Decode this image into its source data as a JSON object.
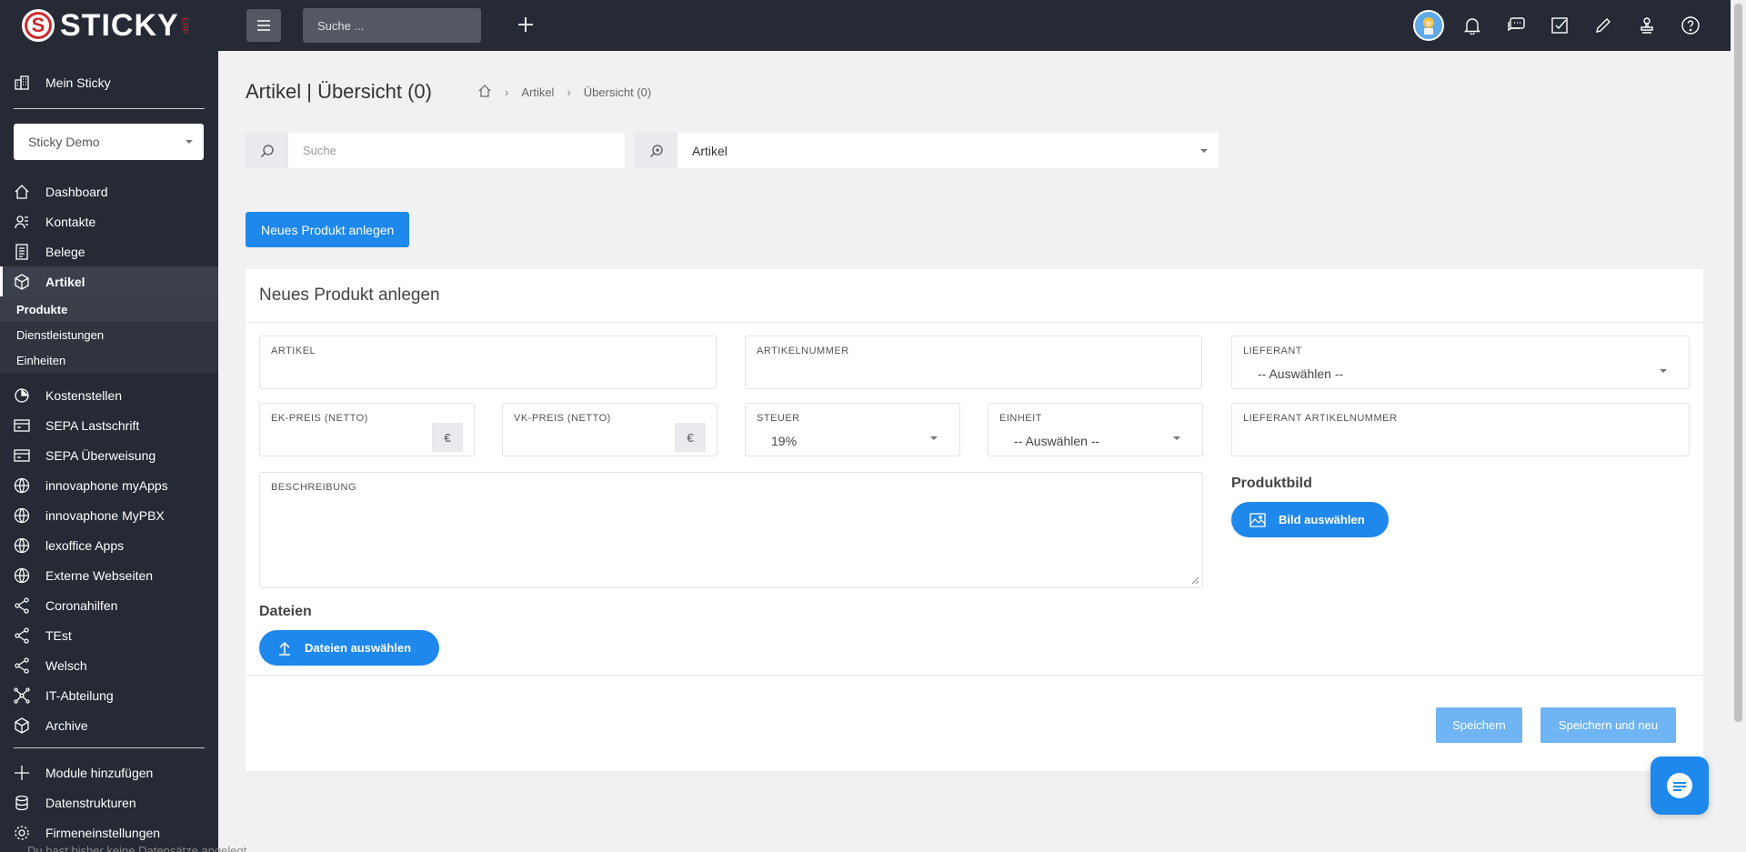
{
  "sidebar": {
    "logo_text": "STICKY",
    "logo_sub": "ERP",
    "top_item": "Mein Sticky",
    "workspace": "Sticky Demo",
    "items": [
      {
        "label": "Dashboard",
        "icon": "home-icon"
      },
      {
        "label": "Kontakte",
        "icon": "contacts-icon"
      },
      {
        "label": "Belege",
        "icon": "document-icon"
      },
      {
        "label": "Artikel",
        "icon": "box-icon"
      }
    ],
    "sub_items": [
      "Produkte",
      "Dienstleistungen",
      "Einheiten"
    ],
    "items2": [
      {
        "label": "Kostenstellen",
        "icon": "pie-icon"
      },
      {
        "label": "SEPA Lastschrift",
        "icon": "card-icon"
      },
      {
        "label": "SEPA Überweisung",
        "icon": "card-icon"
      },
      {
        "label": "innovaphone myApps",
        "icon": "globe-icon"
      },
      {
        "label": "innovaphone MyPBX",
        "icon": "globe-icon"
      },
      {
        "label": "lexoffice Apps",
        "icon": "globe-icon"
      },
      {
        "label": "Externe Webseiten",
        "icon": "globe-icon"
      },
      {
        "label": "Coronahilfen",
        "icon": "share-icon"
      },
      {
        "label": "TEst",
        "icon": "share-icon"
      },
      {
        "label": "Welsch",
        "icon": "share-icon"
      },
      {
        "label": "IT-Abteilung",
        "icon": "network-icon"
      },
      {
        "label": "Archive",
        "icon": "box-icon"
      }
    ],
    "bottom_items": [
      {
        "label": "Module hinzufügen",
        "icon": "plus-icon"
      },
      {
        "label": "Datenstrukturen",
        "icon": "database-icon"
      },
      {
        "label": "Firmeneinstellungen",
        "icon": "gear-icon"
      }
    ]
  },
  "topbar": {
    "search_placeholder": "Suche ..."
  },
  "page": {
    "title": "Artikel | Übersicht (0)",
    "breadcrumb": [
      "Artikel",
      "Übersicht (0)"
    ],
    "search_placeholder": "Suche",
    "filter_value": "Artikel",
    "new_button": "Neues Produkt anlegen",
    "bottom_note": "Du hast bisher keine Datensätze angelegt."
  },
  "form": {
    "title": "Neues Produkt anlegen",
    "artikel_label": "ARTIKEL",
    "artikelnummer_label": "ARTIKELNUMMER",
    "lieferant_label": "LIEFERANT",
    "lieferant_value": "-- Auswählen --",
    "ek_label": "EK-PREIS (NETTO)",
    "vk_label": "VK-PREIS (NETTO)",
    "currency": "€",
    "steuer_label": "STEUER",
    "steuer_value": "19%",
    "einheit_label": "EINHEIT",
    "einheit_value": "-- Auswählen --",
    "lieferant_artnr_label": "LIEFERANT ARTIKELNUMMER",
    "beschreibung_label": "BESCHREIBUNG",
    "produktbild_label": "Produktbild",
    "bild_button": "Bild auswählen",
    "dateien_label": "Dateien",
    "dateien_button": "Dateien auswählen",
    "save_button": "Speichern",
    "save_new_button": "Speichern und neu"
  },
  "colors": {
    "sidebar_bg": "#262a35",
    "primary": "#1e88ec",
    "primary_light": "#6fb4f3",
    "brand_red": "#d2232a"
  }
}
